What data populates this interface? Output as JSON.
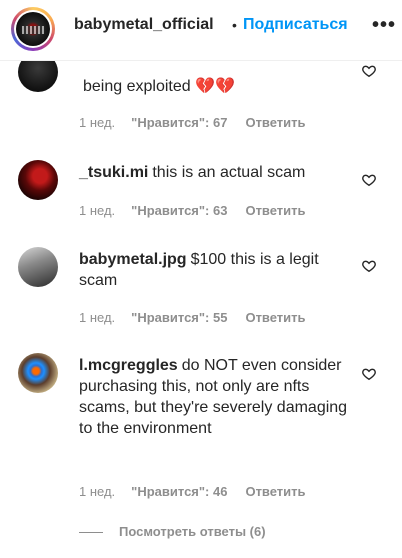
{
  "header": {
    "username": "babymetal_official",
    "separator": "•",
    "follow_label": "Подписаться",
    "more_glyph": "•••"
  },
  "comments": [
    {
      "author": "",
      "text": "being exploited 💔💔",
      "time": "1 нед.",
      "likes": "\"Нравится\": 67",
      "reply_label": "Ответить",
      "avatar_icon": "avatar-dark"
    },
    {
      "author": "_tsuki.mi",
      "text": "this is an actual scam",
      "time": "1 нед.",
      "likes": "\"Нравится\": 63",
      "reply_label": "Ответить",
      "avatar_icon": "avatar-red"
    },
    {
      "author": "babymetal.jpg",
      "text": "$100 this is a legit scam",
      "time": "1 нед.",
      "likes": "\"Нравится\": 55",
      "reply_label": "Ответить",
      "avatar_icon": "avatar-gray"
    },
    {
      "author": "l.mcgreggles",
      "text": "do NOT even consider purchasing this, not only are nfts scams, but they're severely damaging to the environment",
      "time": "1 нед.",
      "likes": "\"Нравится\": 46",
      "reply_label": "Ответить",
      "avatar_icon": "avatar-photo"
    }
  ],
  "view_replies_label": "Посмотреть ответы (6)",
  "colors": {
    "link": "#0095f6",
    "muted": "#8e8e8e",
    "text": "#262626"
  }
}
